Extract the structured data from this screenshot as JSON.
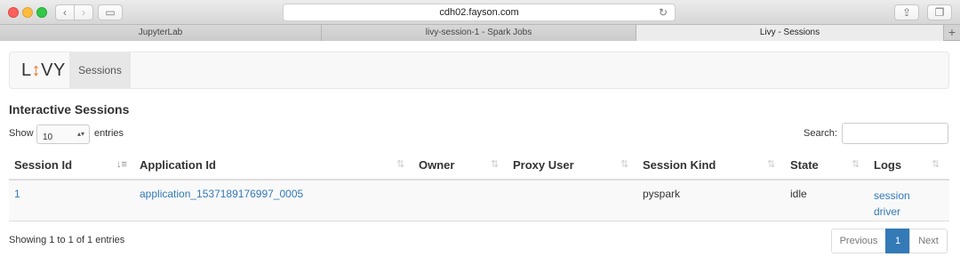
{
  "browser": {
    "url": "cdh02.fayson.com",
    "tabs": [
      {
        "label": "JupyterLab"
      },
      {
        "label": "livy-session-1 - Spark Jobs"
      },
      {
        "label": "Livy - Sessions"
      }
    ],
    "new_tab": "+"
  },
  "navbar": {
    "logo_prefix": "L",
    "logo_io": "↕",
    "logo_suffix": "VY",
    "nav_item": "Sessions"
  },
  "section_title": "Interactive Sessions",
  "length_menu": {
    "show_label": "Show",
    "selected": "10",
    "entries_label": "entries"
  },
  "search": {
    "label": "Search:",
    "value": ""
  },
  "table": {
    "columns": [
      "Session Id",
      "Application Id",
      "Owner",
      "Proxy User",
      "Session Kind",
      "State",
      "Logs"
    ],
    "rows": [
      {
        "session_id": "1",
        "application_id": "application_1537189176997_0005",
        "owner": "",
        "proxy_user": "",
        "session_kind": "pyspark",
        "state": "idle",
        "logs": [
          "session",
          "driver"
        ]
      }
    ]
  },
  "info": "Showing 1 to 1 of 1 entries",
  "pagination": {
    "previous": "Previous",
    "current": "1",
    "next": "Next"
  },
  "colors": {
    "link": "#337ab7",
    "accent_logo": "#e8772e"
  }
}
